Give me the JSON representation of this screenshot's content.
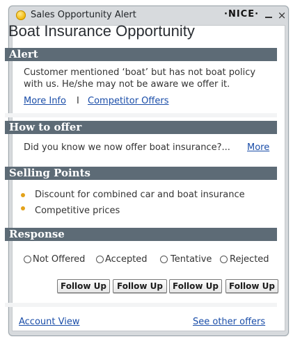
{
  "window": {
    "title": "Sales Opportunity Alert",
    "brand": "·NICE·",
    "minimize_symbol": "",
    "close_symbol": "×"
  },
  "heading": "Boat Insurance Opportunity",
  "alert": {
    "header": "Alert",
    "line1": "Customer mentioned ‘boat’ but has not boat policy",
    "line2": "with us. He/she may not be aware we offer it.",
    "more_info": "More Info",
    "separator": "I",
    "competitor_offers": "Competitor Offers"
  },
  "how_to_offer": {
    "header": "How to offer",
    "text": "Did you know we now offer boat insurance?...",
    "more": "More"
  },
  "selling_points": {
    "header": "Selling Points",
    "items": [
      "Discount for combined car and boat insurance",
      "Competitive prices"
    ]
  },
  "response": {
    "header": "Response",
    "options": [
      "Not Offered",
      "Accepted",
      "Tentative",
      "Rejected"
    ],
    "buttons": [
      "Follow Up",
      "Follow Up",
      "Follow Up",
      "Follow Up"
    ]
  },
  "footer": {
    "account_view": "Account View",
    "see_other_offers": "See other offers"
  },
  "colors": {
    "section_header_bg": "#5d6b76",
    "link": "#1a4da8",
    "bullet": "#e3a21a",
    "window_chrome": "#d7dadd"
  },
  "icons": {
    "title": "alert-icon",
    "minimize": "minimize-icon",
    "close": "close-icon"
  }
}
